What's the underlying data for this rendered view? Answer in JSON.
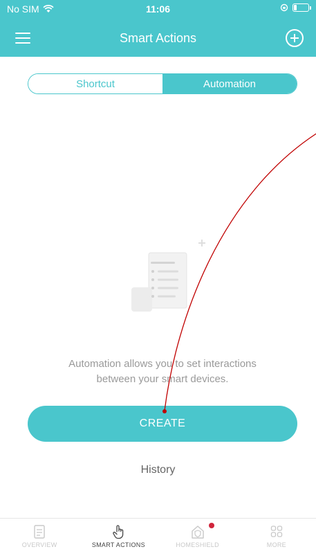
{
  "status_bar": {
    "carrier": "No SIM",
    "time": "11:06"
  },
  "header": {
    "title": "Smart Actions",
    "menu_icon": "hamburger-menu-icon",
    "add_icon": "add-circle-icon"
  },
  "segmented": {
    "items": [
      {
        "label": "Shortcut",
        "selected": false
      },
      {
        "label": "Automation",
        "selected": true
      }
    ]
  },
  "empty_state": {
    "illustration_icon": "document-list-icon",
    "description_line1": "Automation allows you to set interactions",
    "description_line2": "between your smart devices."
  },
  "create_button": {
    "label": "CREATE"
  },
  "history_link": {
    "label": "History"
  },
  "tab_bar": {
    "tabs": [
      {
        "label": "OVERVIEW",
        "icon": "overview-icon",
        "active": false
      },
      {
        "label": "SMART ACTIONS",
        "icon": "hand-pointer-icon",
        "active": true
      },
      {
        "label": "HOMESHIELD",
        "icon": "home-shield-icon",
        "active": false,
        "badge": true
      },
      {
        "label": "MORE",
        "icon": "grid-more-icon",
        "active": false
      }
    ]
  },
  "colors": {
    "accent": "#4ac6cc",
    "annotation": "#c00000",
    "badge": "#d0243b"
  }
}
